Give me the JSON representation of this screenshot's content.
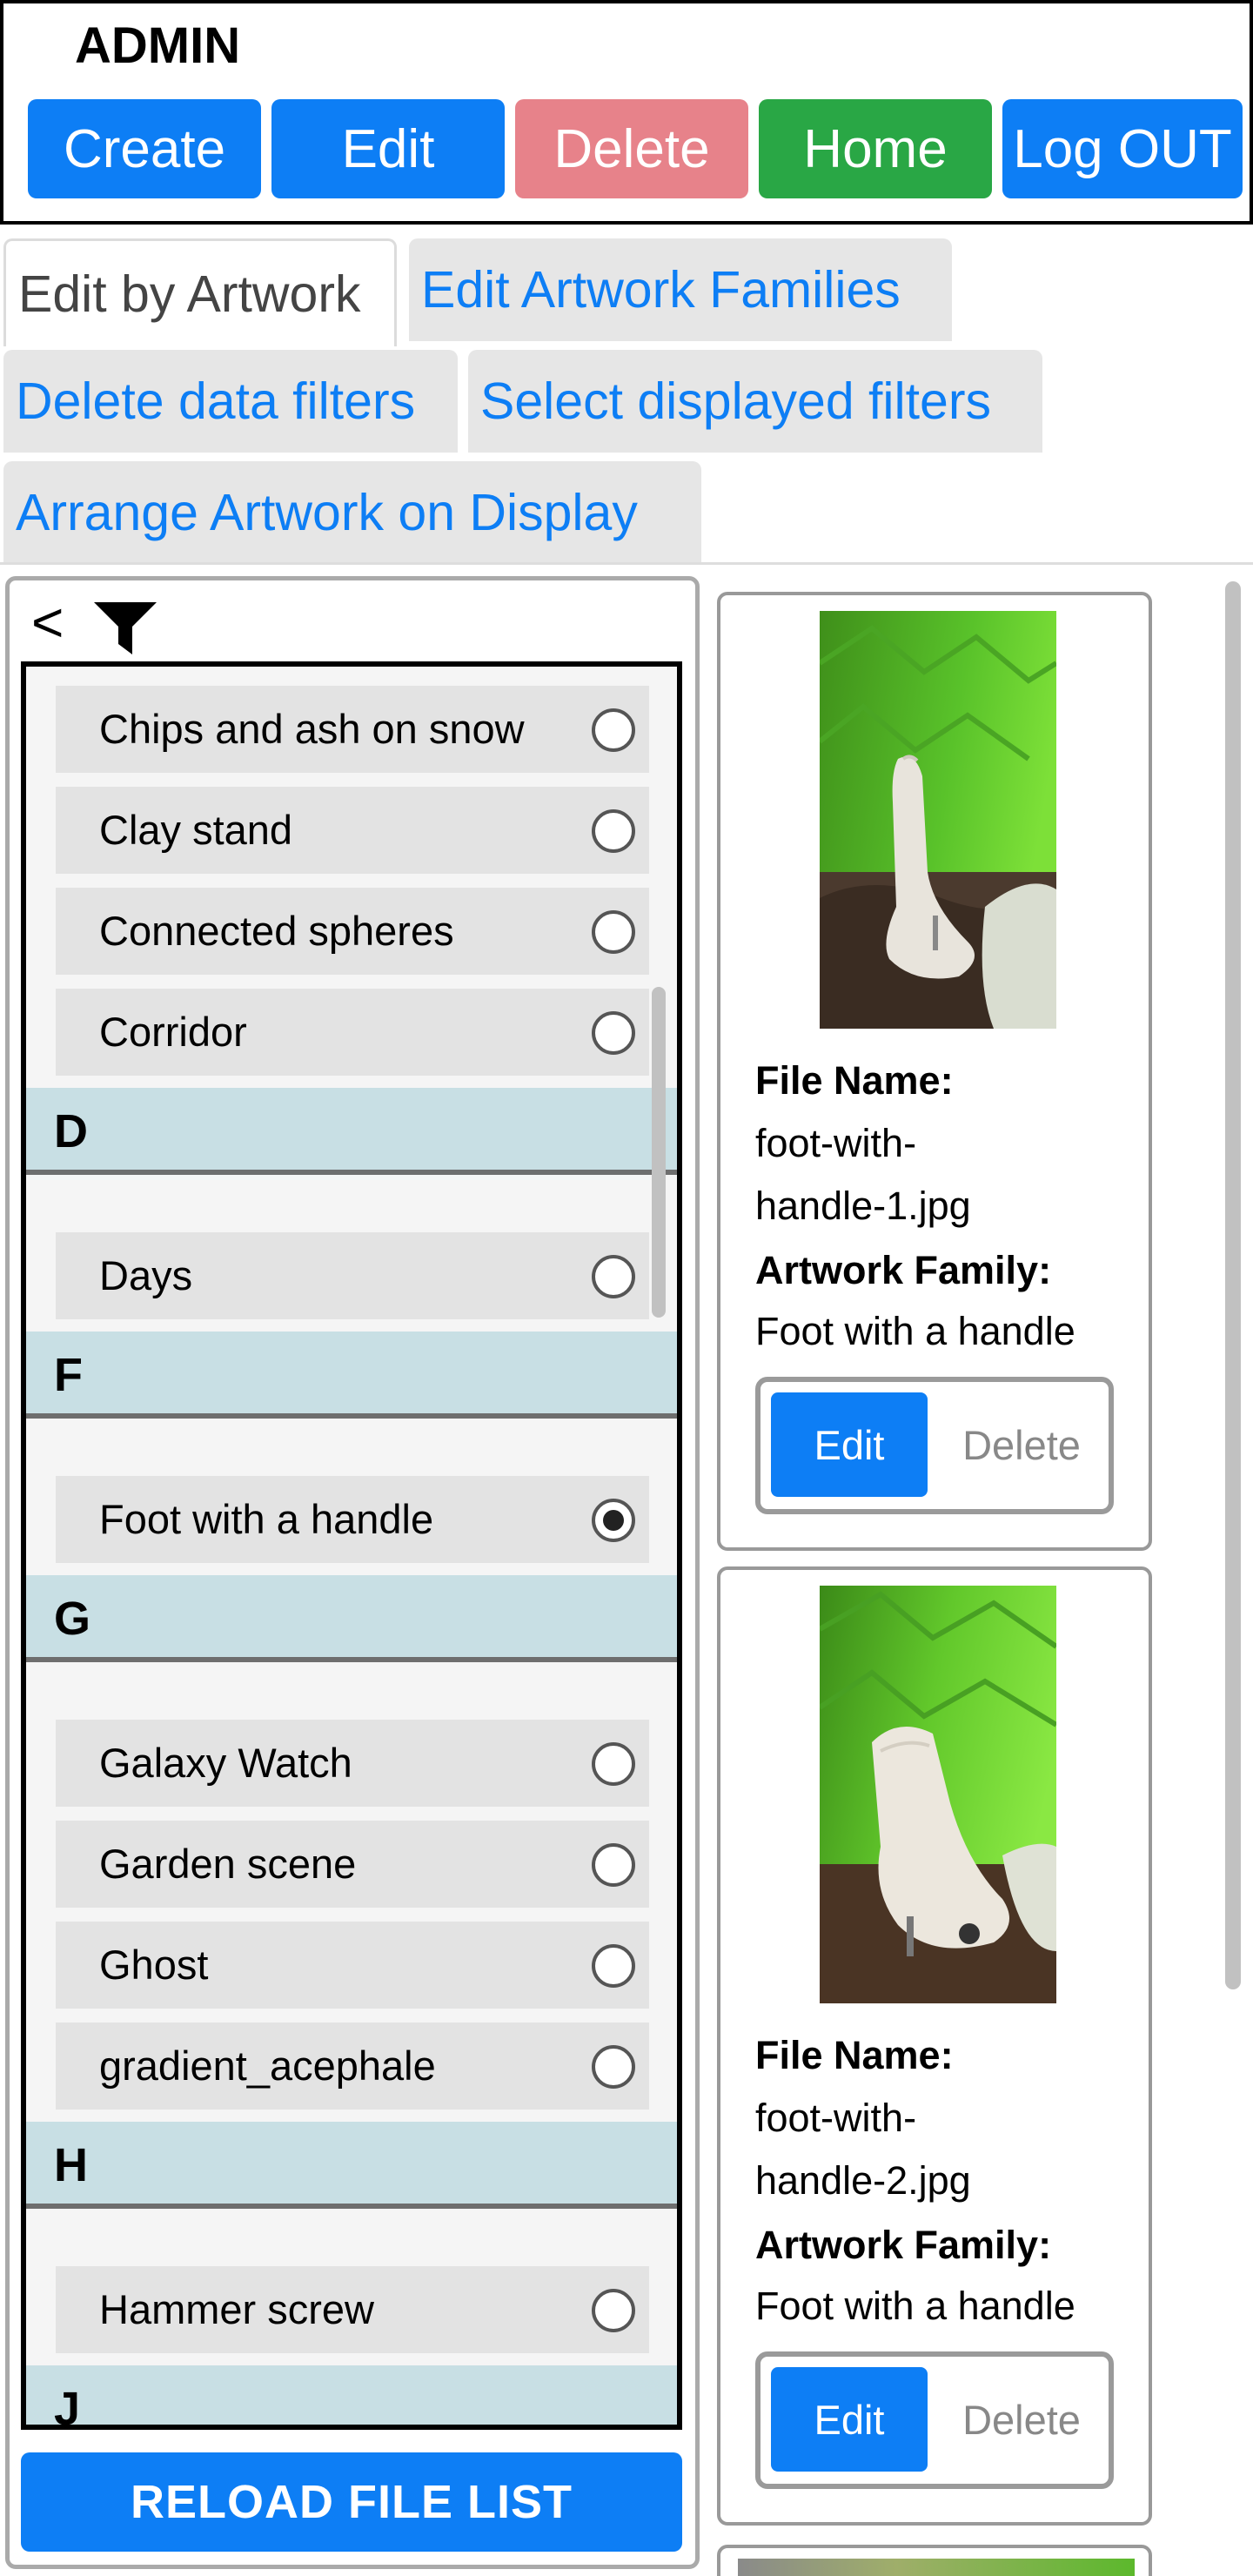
{
  "header": {
    "title": "ADMIN",
    "buttons": {
      "create": "Create",
      "edit": "Edit",
      "delete": "Delete",
      "home": "Home",
      "logout": "Log OUT"
    }
  },
  "tabs": {
    "edit_by_artwork": "Edit by Artwork",
    "edit_families": "Edit Artwork Families",
    "delete_filters": "Delete data filters",
    "select_filters": "Select displayed filters",
    "arrange_artwork": "Arrange Artwork on Display",
    "active": "Edit by Artwork"
  },
  "filter_panel": {
    "back_glyph": "<",
    "sections": [
      {
        "letter": "",
        "items": [
          {
            "label": "Chips and ash on snow",
            "selected": false
          },
          {
            "label": "Clay stand",
            "selected": false
          },
          {
            "label": "Connected spheres",
            "selected": false
          },
          {
            "label": "Corridor",
            "selected": false
          }
        ]
      },
      {
        "letter": "D",
        "items": [
          {
            "label": "Days",
            "selected": false
          }
        ]
      },
      {
        "letter": "F",
        "items": [
          {
            "label": "Foot with a handle",
            "selected": true
          }
        ]
      },
      {
        "letter": "G",
        "items": [
          {
            "label": "Galaxy Watch",
            "selected": false
          },
          {
            "label": "Garden scene",
            "selected": false
          },
          {
            "label": "Ghost",
            "selected": false
          },
          {
            "label": "gradient_acephale",
            "selected": false
          }
        ]
      },
      {
        "letter": "H",
        "items": [
          {
            "label": "Hammer screw",
            "selected": false
          }
        ]
      },
      {
        "letter": "J",
        "items": []
      }
    ],
    "reload_label": "RELOAD FILE LIST"
  },
  "cards": [
    {
      "file_name_label": "File Name:",
      "file_name_line1": "foot-with-",
      "file_name_line2": "handle-1.jpg",
      "family_label": "Artwork Family:",
      "family": "Foot with a handle",
      "edit_label": "Edit",
      "delete_label": "Delete"
    },
    {
      "file_name_label": "File Name:",
      "file_name_line1": "foot-with-",
      "file_name_line2": "handle-2.jpg",
      "family_label": "Artwork Family:",
      "family": "Foot with a handle",
      "edit_label": "Edit",
      "delete_label": "Delete"
    }
  ],
  "colors": {
    "primary": "#0d7ef5",
    "danger_muted": "#e7828a",
    "success": "#29a745",
    "section_header": "#c8dfe4"
  },
  "icons": {
    "filter": "funnel-icon",
    "back": "chevron-left-icon"
  }
}
